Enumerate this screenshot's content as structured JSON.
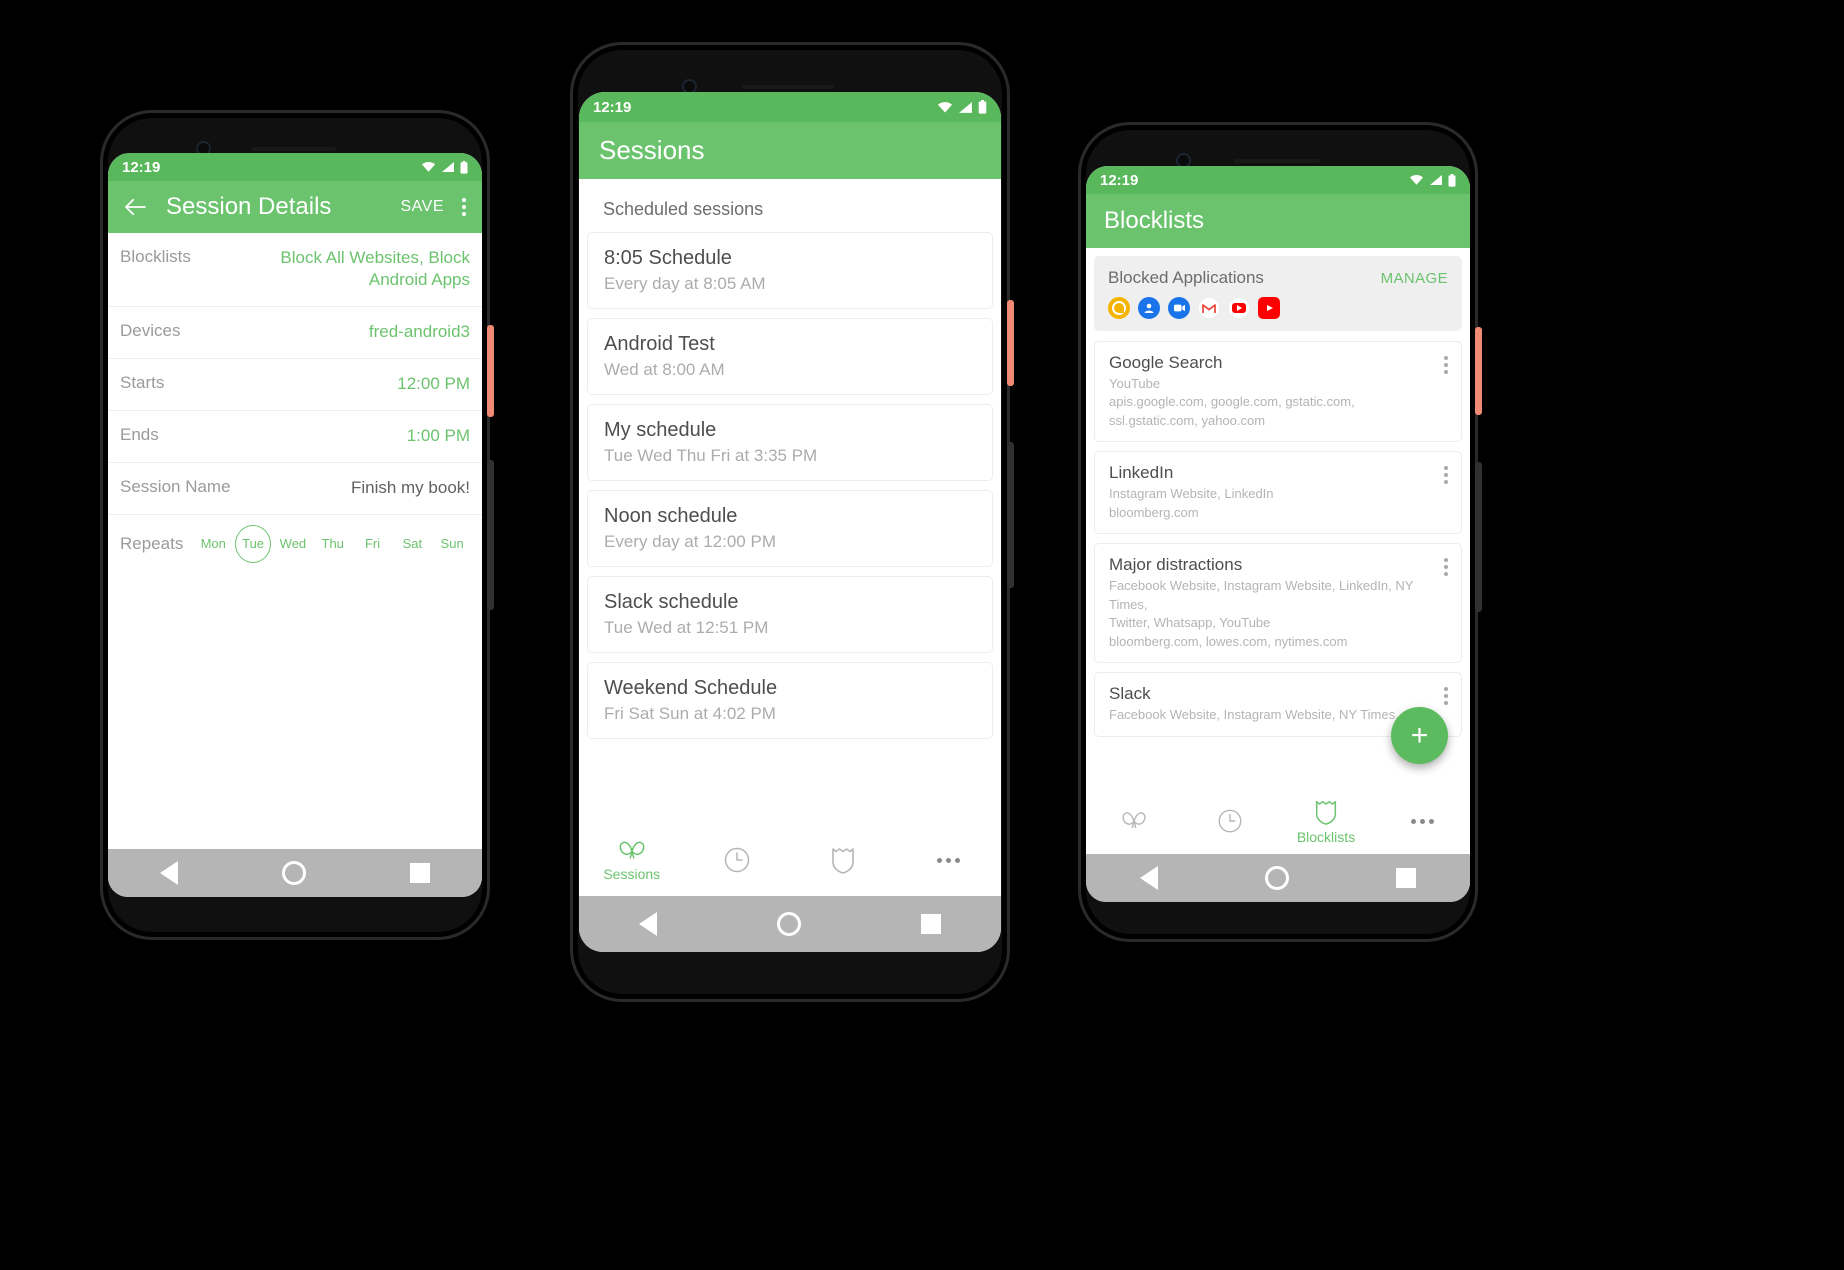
{
  "status_bar": {
    "time": "12:19",
    "icons": [
      "wifi-icon",
      "signal-icon",
      "battery-icon"
    ]
  },
  "phone1": {
    "appbar": {
      "back_icon": "arrow-left-icon",
      "title": "Session Details",
      "save_label": "SAVE",
      "overflow_icon": "kebab-menu-icon"
    },
    "rows": [
      {
        "label": "Blocklists",
        "value": "Block All Websites, Block Android Apps"
      },
      {
        "label": "Devices",
        "value": "fred-android3"
      },
      {
        "label": "Starts",
        "value": "12:00 PM"
      },
      {
        "label": "Ends",
        "value": "1:00 PM"
      },
      {
        "label": "Session Name",
        "value": "Finish my book!"
      }
    ],
    "repeats": {
      "label": "Repeats",
      "days": [
        {
          "label": "Mon",
          "selected": false
        },
        {
          "label": "Tue",
          "selected": true
        },
        {
          "label": "Wed",
          "selected": false
        },
        {
          "label": "Thu",
          "selected": false
        },
        {
          "label": "Fri",
          "selected": false
        },
        {
          "label": "Sat",
          "selected": false
        },
        {
          "label": "Sun",
          "selected": false
        }
      ]
    }
  },
  "phone2": {
    "appbar": {
      "title": "Sessions"
    },
    "section_title": "Scheduled sessions",
    "sessions": [
      {
        "name": "8:05 Schedule",
        "schedule": "Every day at 8:05 AM"
      },
      {
        "name": "Android Test",
        "schedule": "Wed at 8:00 AM"
      },
      {
        "name": "My schedule",
        "schedule": "Tue Wed Thu Fri at 3:35 PM"
      },
      {
        "name": "Noon schedule",
        "schedule": "Every day at 12:00 PM"
      },
      {
        "name": "Slack schedule",
        "schedule": "Tue Wed at 12:51 PM"
      },
      {
        "name": "Weekend Schedule",
        "schedule": "Fri Sat Sun at 4:02 PM"
      }
    ],
    "tabs": [
      {
        "icon": "butterfly-icon",
        "label": "Sessions",
        "active": true
      },
      {
        "icon": "clock-icon",
        "label": "",
        "active": false
      },
      {
        "icon": "shield-icon",
        "label": "",
        "active": false
      },
      {
        "icon": "more-horizontal-icon",
        "label": "",
        "active": false
      }
    ]
  },
  "phone3": {
    "appbar": {
      "title": "Blocklists"
    },
    "blocked_apps": {
      "title": "Blocked Applications",
      "manage_label": "MANAGE",
      "apps": [
        "google-assistant-icon",
        "contacts-icon",
        "duo-video-icon",
        "gmail-icon",
        "youtube-music-icon",
        "youtube-icon"
      ]
    },
    "blocklists": [
      {
        "name": "Google Search",
        "items": "YouTube\napis.google.com, google.com, gstatic.com,\nssl.gstatic.com, yahoo.com"
      },
      {
        "name": "LinkedIn",
        "items": "Instagram Website, LinkedIn\nbloomberg.com"
      },
      {
        "name": "Major distractions",
        "items": "Facebook Website, Instagram Website, LinkedIn, NY Times,\nTwitter, Whatsapp, YouTube\nbloomberg.com, lowes.com, nytimes.com"
      },
      {
        "name": "Slack",
        "items": "Facebook Website, Instagram Website, NY Times, eBay"
      }
    ],
    "fab_label": "+",
    "tabs": [
      {
        "icon": "butterfly-icon",
        "label": "",
        "active": false
      },
      {
        "icon": "clock-icon",
        "label": "",
        "active": false
      },
      {
        "icon": "shield-icon",
        "label": "Blocklists",
        "active": true
      },
      {
        "icon": "more-horizontal-icon",
        "label": "",
        "active": false
      }
    ]
  },
  "colors": {
    "accent": "#6cc36e",
    "status_bar": "#5ab85c",
    "nav_bar": "#b5b5b5",
    "fab": "#5cbb5e"
  }
}
